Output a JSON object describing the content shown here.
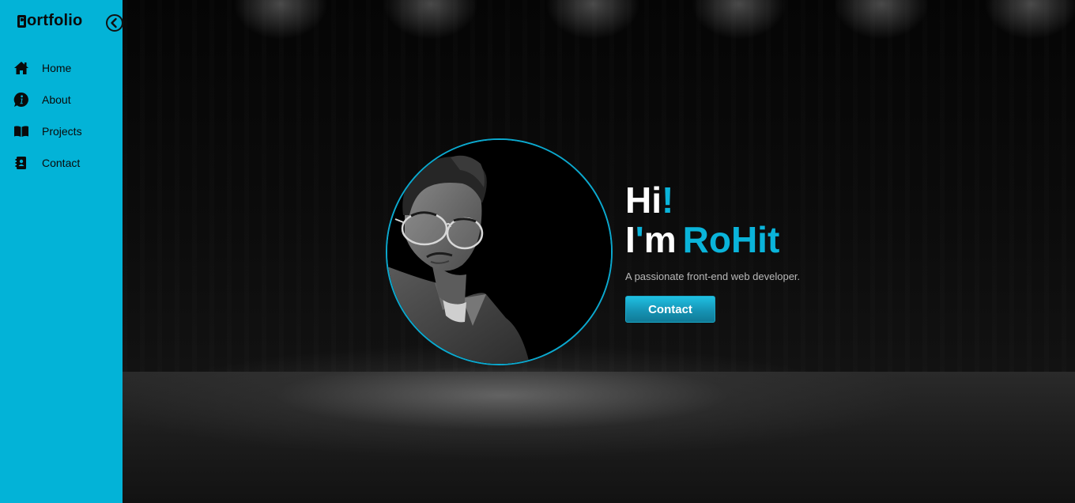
{
  "sidebar": {
    "brand": {
      "logo_letter": "P",
      "text": "ortfolio"
    },
    "collapse_icon": "chevron-left-circle-icon",
    "items": [
      {
        "label": "Home",
        "icon": "home-icon"
      },
      {
        "label": "About",
        "icon": "info-icon"
      },
      {
        "label": "Projects",
        "icon": "book-open-icon"
      },
      {
        "label": "Contact",
        "icon": "contact-card-icon"
      }
    ]
  },
  "hero": {
    "greeting": "Hi",
    "greeting_mark": "!",
    "intro_i": "I",
    "intro_apostrophe": "'",
    "intro_m": "m",
    "name": "RoHit",
    "subtitle": "A passionate front-end web developer.",
    "contact_label": "Contact"
  },
  "colors": {
    "sidebar_bg": "#03b3d7",
    "accent": "#0ab4da",
    "text_light": "#ffffff",
    "subtitle": "#b9b9b9",
    "stage_bg": "#0b0b0b"
  }
}
